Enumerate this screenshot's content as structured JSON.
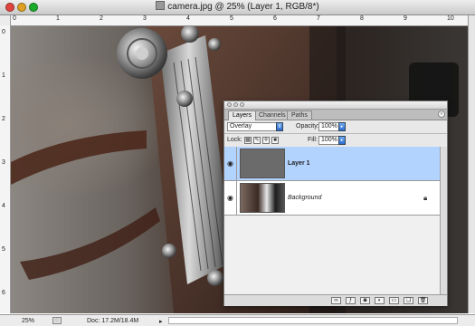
{
  "window": {
    "title": "camera.jpg @ 25% (Layer 1, RGB/8*)"
  },
  "rulers": {
    "top_labels": [
      "0",
      "1",
      "2",
      "3",
      "4",
      "5",
      "6",
      "7",
      "8",
      "9",
      "10"
    ],
    "left_labels": [
      "0",
      "1",
      "2",
      "3",
      "4",
      "5",
      "6"
    ]
  },
  "status_bar": {
    "zoom": "25%",
    "doc_info": "Doc: 17.2M/18.4M",
    "arrow": "▸"
  },
  "layers_panel": {
    "tabs": [
      {
        "label": "Layers",
        "active": true
      },
      {
        "label": "Channels",
        "active": false
      },
      {
        "label": "Paths",
        "active": false
      }
    ],
    "blend_mode": "Overlay",
    "opacity_label": "Opacity:",
    "opacity_value": "100%",
    "lock_label": "Lock:",
    "fill_label": "Fill:",
    "fill_value": "100%",
    "layers": [
      {
        "name": "Layer 1",
        "visible": true,
        "selected": true
      },
      {
        "name": "Background",
        "visible": true,
        "selected": false,
        "locked": true
      }
    ],
    "bottom_buttons": [
      "link-layers",
      "layer-style",
      "layer-mask",
      "adjustment-layer",
      "new-group",
      "new-layer",
      "delete-layer"
    ]
  },
  "colors": {
    "selection_highlight": "#b3d3ff",
    "close_button": "#e0443e",
    "minimize_button": "#dea123",
    "zoom_button": "#1aab29"
  }
}
